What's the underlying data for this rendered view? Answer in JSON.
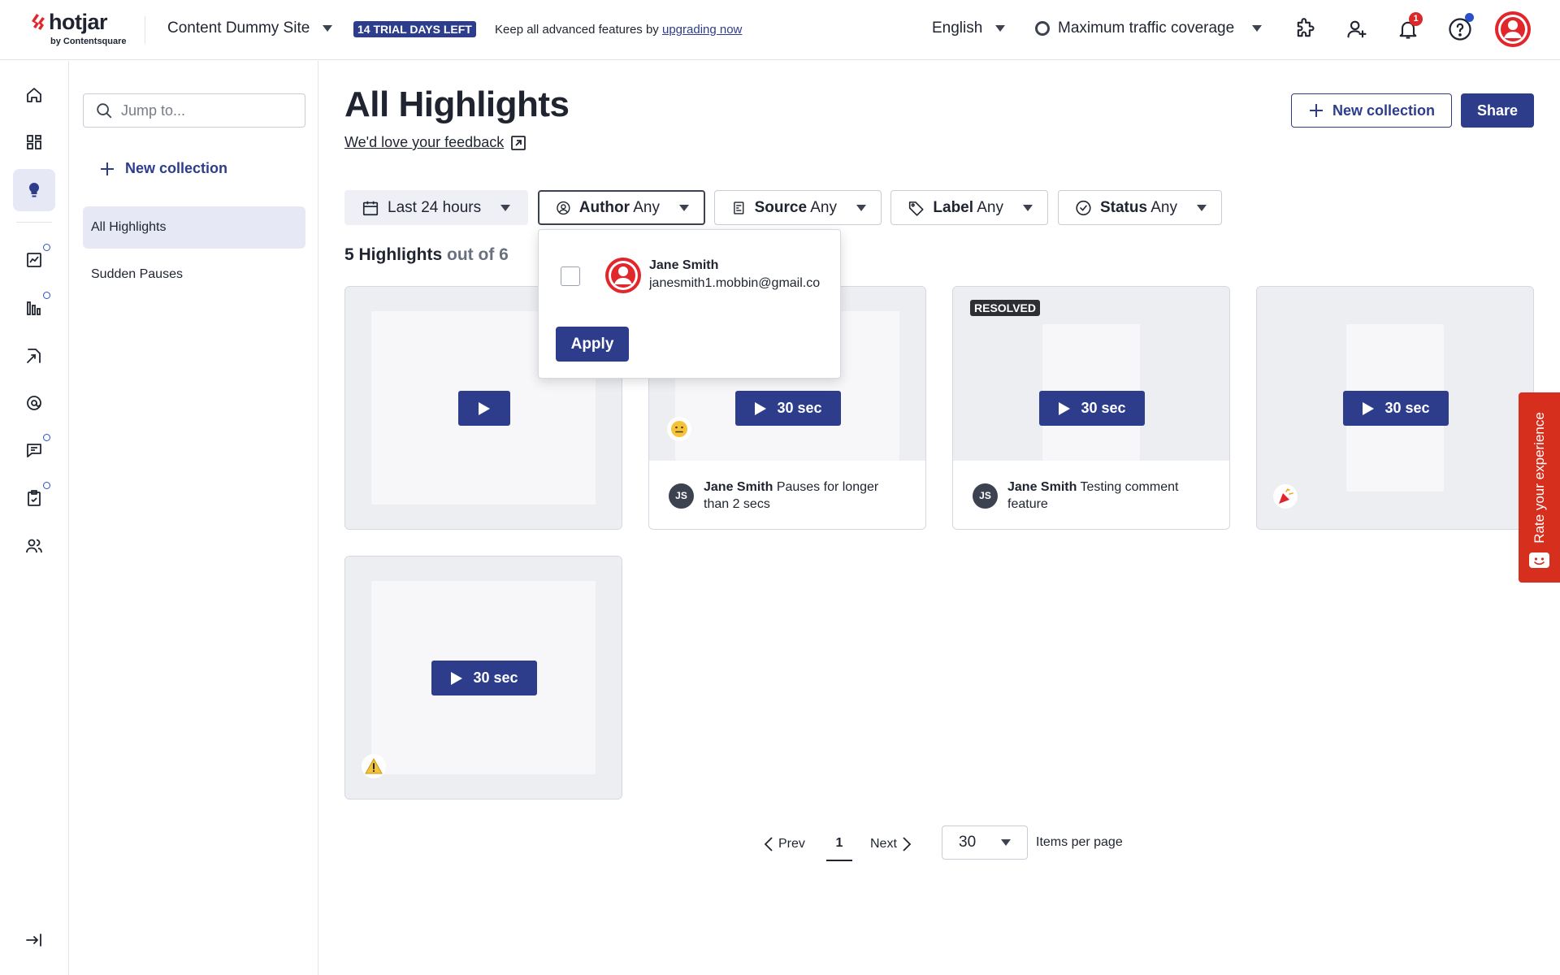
{
  "brand": {
    "name": "hotjar",
    "sub": "by Contentsquare",
    "accent": "#2d3d8c",
    "logo_color": "#e1262c"
  },
  "topbar": {
    "site": "Content Dummy Site",
    "trial_badge": "14 TRIAL DAYS LEFT",
    "trial_text": "Keep all advanced features by ",
    "trial_link": "upgrading now",
    "language": "English",
    "traffic": "Maximum traffic coverage",
    "notification_count": "1",
    "icons": [
      "integrations-icon",
      "add-user-icon",
      "bell-icon",
      "help-icon",
      "user-avatar"
    ]
  },
  "rail": {
    "icons": [
      "home-icon",
      "dashboard-icon",
      "highlights-icon",
      "trends-icon",
      "heatmaps-icon",
      "recordings-icon",
      "feedback-icon",
      "surveys-icon",
      "interviews-icon",
      "users-icon",
      "collapse-icon"
    ]
  },
  "sidebar": {
    "search_placeholder": "Jump to...",
    "new_collection": "New collection",
    "items": [
      {
        "label": "All Highlights",
        "active": true
      },
      {
        "label": "Sudden Pauses",
        "active": false
      }
    ]
  },
  "main": {
    "title": "All Highlights",
    "feedback_link": "We'd love your feedback",
    "new_collection_button": "New collection",
    "share_button": "Share",
    "filters": {
      "date": "Last 24 hours",
      "author": {
        "label": "Author",
        "value": "Any"
      },
      "source": {
        "label": "Source",
        "value": "Any"
      },
      "label": {
        "label": "Label",
        "value": "Any"
      },
      "status": {
        "label": "Status",
        "value": "Any"
      }
    },
    "count": {
      "shown": "5 Highlights",
      "total": "out of 6"
    }
  },
  "author_dropdown": {
    "name": "Jane Smith",
    "email": "janesmith1.mobbin@gmail.co",
    "apply": "Apply"
  },
  "cards": [
    {
      "duration": "",
      "author": "",
      "comment": "",
      "badge": "",
      "emoji": ""
    },
    {
      "duration": "30 sec",
      "author": "Jane Smith",
      "comment": "Pauses for longer than 2 secs",
      "initials": "JS",
      "badge": "",
      "emoji": "neutral-face"
    },
    {
      "duration": "30 sec",
      "author": "Jane Smith",
      "comment": "Testing comment feature",
      "initials": "JS",
      "badge": "RESOLVED",
      "emoji": ""
    },
    {
      "duration": "30 sec",
      "author": "",
      "comment": "",
      "badge": "",
      "emoji": "party-popper"
    },
    {
      "duration": "30 sec",
      "author": "",
      "comment": "",
      "badge": "",
      "emoji": "warning"
    }
  ],
  "pagination": {
    "prev": "Prev",
    "page": "1",
    "next": "Next",
    "per_page": "30",
    "per_page_label": "Items per page"
  },
  "rate_tab": "Rate your experience"
}
